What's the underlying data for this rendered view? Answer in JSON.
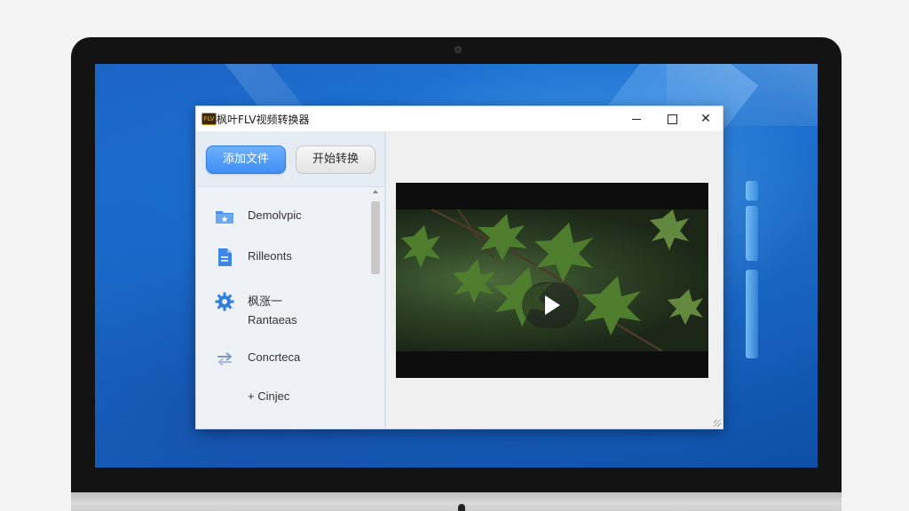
{
  "app": {
    "title": "枫叶FLV视频转换器",
    "icon_text": "FLV"
  },
  "toolbar": {
    "add_file_label": "添加文件",
    "start_convert_label": "开始转换"
  },
  "sidebar": {
    "items": [
      {
        "icon": "folder-icon",
        "label": "Demolvpic"
      },
      {
        "icon": "document-icon",
        "label": "Rilleonts"
      },
      {
        "icon": "gear-icon",
        "label": "枫涨一",
        "sublabel": "Rantaeas"
      },
      {
        "icon": "convert-arrows-icon",
        "label": "Concrteca"
      },
      {
        "icon": "plus-icon",
        "label": "+ Cinjec"
      }
    ]
  },
  "preview": {
    "icon": "play-icon"
  },
  "colors": {
    "accent": "#3d8ef3",
    "desktop": "#1b6fd0",
    "window_bg": "#f0f0f0"
  }
}
